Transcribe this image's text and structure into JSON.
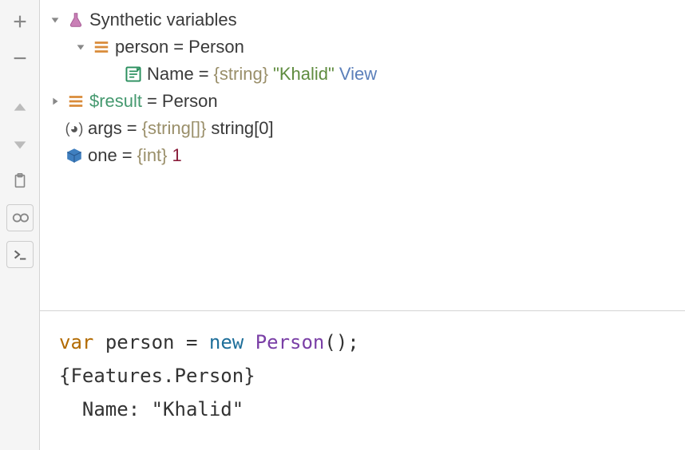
{
  "toolbar": {
    "add": "add",
    "remove": "remove",
    "up": "up",
    "down": "down",
    "clipboard": "clipboard",
    "glasses": "glasses",
    "console": "console"
  },
  "vars": {
    "synthetic_label": "Synthetic variables",
    "person": {
      "name_label": "person",
      "eq": "=",
      "type": "Person",
      "fields": {
        "name": {
          "label": "Name",
          "eq": "=",
          "type": "{string}",
          "value": "\"Khalid\"",
          "view": "View"
        }
      }
    },
    "result": {
      "name_label": "$result",
      "eq": "=",
      "type": "Person"
    },
    "args": {
      "name_label": "args",
      "eq": "=",
      "type": "{string[]}",
      "value": "string[0]"
    },
    "one": {
      "name_label": "one",
      "eq": "=",
      "type": "{int}",
      "value": "1"
    }
  },
  "console": {
    "kw_var": "var",
    "ident": "person",
    "eq": "=",
    "kw_new": "new",
    "ctor": "Person",
    "parens": "();",
    "line2": "{Features.Person}",
    "name_lbl": "Name:",
    "name_val": "\"Khalid\""
  }
}
